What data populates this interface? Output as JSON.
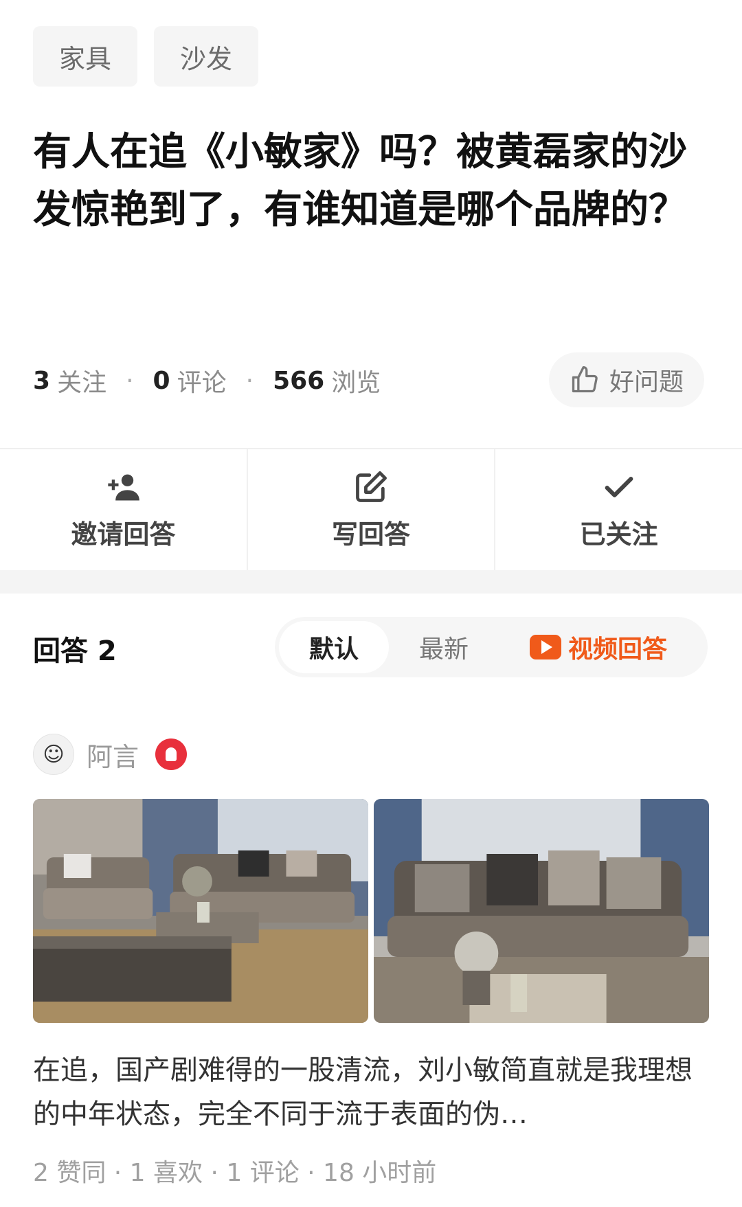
{
  "tags": [
    "家具",
    "沙发"
  ],
  "question": {
    "title": "有人在追《小敏家》吗？被黄磊家的沙发惊艳到了，有谁知道是哪个品牌的？"
  },
  "stats": {
    "follow_count": "3",
    "follow_label": "关注",
    "comment_count": "0",
    "comment_label": "评论",
    "view_count": "566",
    "view_label": "浏览",
    "good_question": "好问题"
  },
  "actions": {
    "invite": "邀请回答",
    "write": "写回答",
    "followed": "已关注"
  },
  "answers_header": "回答 2",
  "sort": {
    "default": "默认",
    "latest": "最新",
    "video": "视频回答"
  },
  "answer": {
    "author": "阿言",
    "avatar_glyph": "☺",
    "excerpt": "在追，国产剧难得的一股清流，刘小敏简直就是我理想的中年状态，完全不同于流于表面的伪…",
    "meta": "2 赞同 · 1 喜欢 · 1 评论 · 18 小时前"
  },
  "colors": {
    "accent": "#f05a1a",
    "badge": "#e8303c"
  },
  "icons": [
    "thumbs-up-icon",
    "add-user-icon",
    "edit-icon",
    "check-icon",
    "play-icon",
    "badge-icon"
  ]
}
